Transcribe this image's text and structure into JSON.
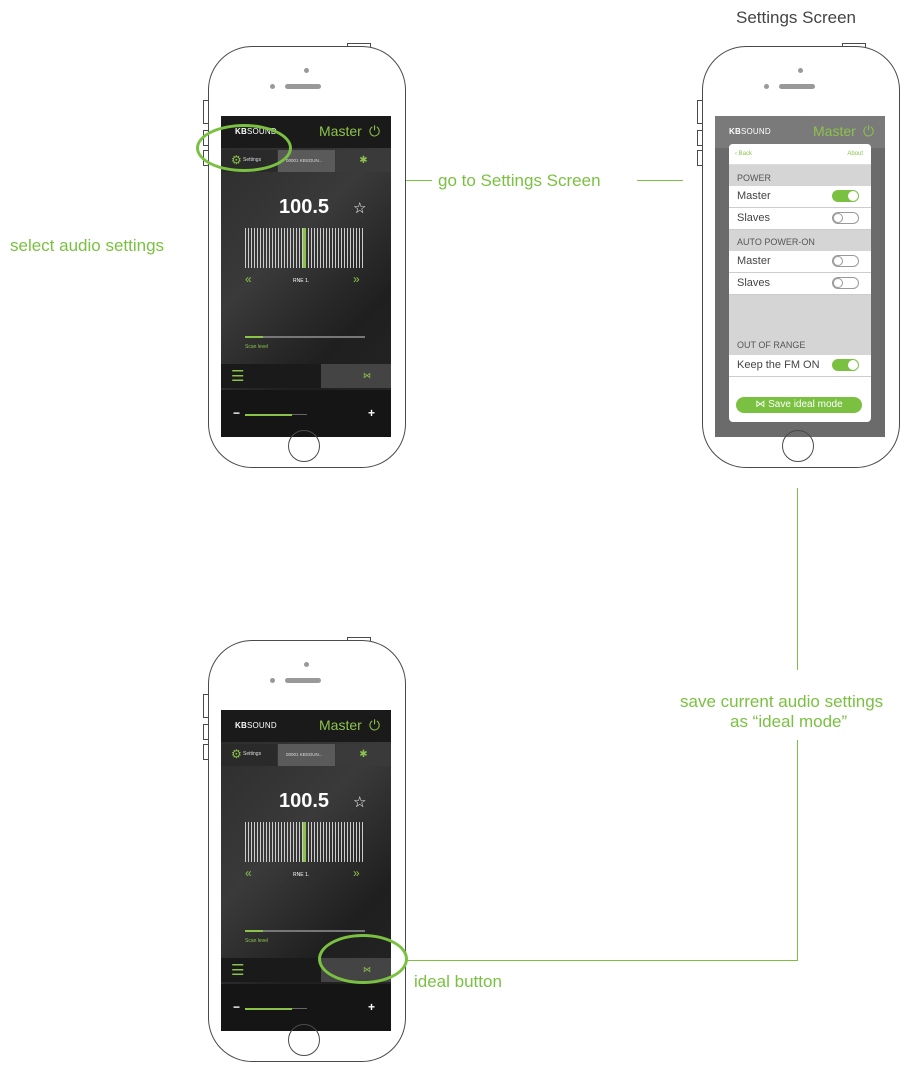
{
  "annotations": {
    "settings_screen_title": "Settings Screen",
    "select_audio": "select audio settings",
    "go_to_settings": "go to Settings Screen",
    "save_current_line1": "save current audio settings",
    "save_current_line2": "as “ideal mode”",
    "ideal_button": "ideal button"
  },
  "app": {
    "brand_bold": "KB",
    "brand_rest": "SOUND",
    "mode": "Master",
    "power_icon": "power-icon",
    "settings_tab": "Settings",
    "device_tab": "00001 KBSOUN...",
    "bluetooth_icon": "bluetooth-icon",
    "frequency": "100.5",
    "favorite_icon": "star-icon",
    "prev_icon": "«",
    "next_icon": "»",
    "station": "RNE 1.",
    "scan_label": "Scan level",
    "scan_level_fraction": 0.15,
    "volume_fraction": 0.75,
    "minus": "−",
    "plus": "+"
  },
  "settings": {
    "back": "Back",
    "about": "About",
    "power_header": "POWER",
    "power_master": "Master",
    "power_slaves": "Slaves",
    "auto_header": "AUTO POWER-ON",
    "auto_master": "Master",
    "auto_slaves": "Slaves",
    "range_header": "OUT OF RANGE",
    "keep_fm": "Keep the FM ON",
    "save_ideal": "Save ideal mode",
    "toggles": {
      "power_master": true,
      "power_slaves": false,
      "auto_master": false,
      "auto_slaves": false,
      "keep_fm": true
    }
  },
  "colors": {
    "accent": "#7ac142",
    "screen": "#2b2b2b"
  }
}
